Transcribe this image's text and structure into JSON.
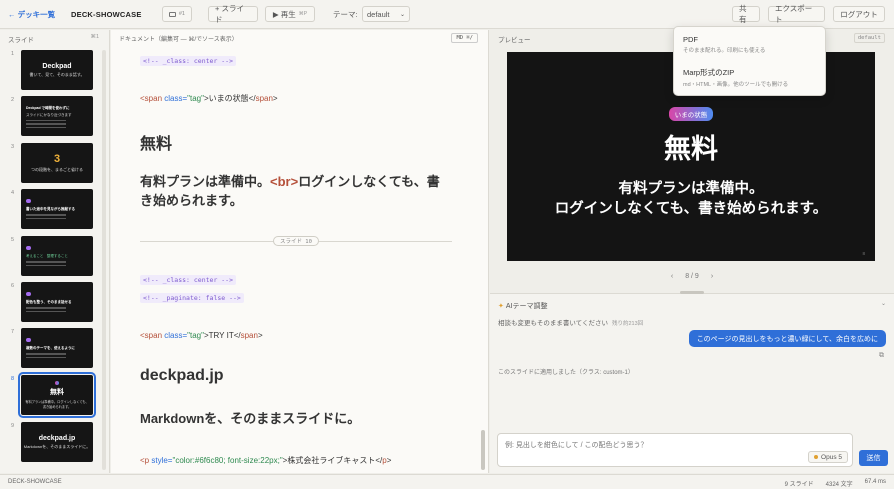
{
  "topbar": {
    "back": "← デッキ一覧",
    "title": "DECK-SHOWCASE",
    "slide_indicator": "#1",
    "add_slide": "+ スライド",
    "play": "▶ 再生",
    "play_shortcut": "⌘P",
    "theme_label": "テーマ:",
    "theme_value": "default",
    "share": "共有",
    "export": "エクスポート",
    "logout": "ログアウト"
  },
  "sidebar": {
    "header": "スライド",
    "header_right": "⌘1",
    "thumbs": [
      {
        "num": "1",
        "t1": "Deckpad",
        "t2": "書いて、見て、そのまま話す。"
      },
      {
        "num": "2",
        "t1": "Deckpad で時間を使わずに",
        "t2": "スライドにかなり近づきます"
      },
      {
        "num": "3",
        "big": "3",
        "t2": "つの段階を、まるごと省ける"
      },
      {
        "num": "4",
        "t1": "書いた途中を見ながら推敲する",
        "t2": ""
      },
      {
        "num": "5",
        "t1": "考えること　整理すること",
        "t2": ""
      },
      {
        "num": "6",
        "t1": "配色も整う、そのまま話せる",
        "t2": ""
      },
      {
        "num": "7",
        "t1": "複数のテーマを、使えるように",
        "t2": ""
      },
      {
        "num": "8",
        "t1": "無料",
        "t2": "有料プランは準備中。ログインしなくても、書き始められます。"
      },
      {
        "num": "9",
        "t1": "deckpad.jp",
        "t2": "Markdownを、そのままスライドに。"
      }
    ]
  },
  "doc": {
    "header": "ドキュメント（編集可 — ⌘/でソース表示）",
    "md_button": "MD ⌘/",
    "comment_center": "<!-- _class: center -->",
    "tag_open": "<span",
    "tag_attr": "class=",
    "tag_val": "\"tag\"",
    "tag_text1": ">いまの状態</",
    "tag_close": "span",
    "tag_end": ">",
    "h1_free": "無料",
    "para1_a": "有料プランは準備中。",
    "para1_br": "<br>",
    "para1_b": "ログインしなくても、書き始められます。",
    "separator": "スライド 10",
    "comment_center2": "<!-- _class: center -->",
    "comment_paginate": "<!-- _paginate: false -->",
    "tag_text2": ">TRY IT</",
    "h1_deckpad": "deckpad.jp",
    "para2": "Markdownを、そのままスライドに。",
    "p_open": "<p",
    "p_attr": "style=",
    "p_style": "\"color:#6f6c80; font-size:22px;\"",
    "p_text": ">株式会社ライブキャスト</",
    "p_close": "p"
  },
  "preview": {
    "header": "プレビュー",
    "theme_tag": "default",
    "badge": "いまの状態",
    "title": "無料",
    "body_line1": "有料プランは準備中。",
    "body_line2": "ログインしなくても、書き始められます。",
    "page_small": "8",
    "pager_prev": "‹",
    "pager_text": "8 / 9",
    "pager_next": "›"
  },
  "ai": {
    "header": "AIテーマ調整",
    "note": "相談も変更もそのまま書いてください",
    "note_remaining": "残り約213回",
    "user_message": "このページの見出しをもっと濃い緑にして、余白を広めに",
    "applied": "このスライドに適用しました（クラス: custom-1）",
    "placeholder": "例: 見出しを紺色にして / この配色どう思う？",
    "model": "Opus 5",
    "send": "送信"
  },
  "dropdown": {
    "items": [
      {
        "title": "PDF",
        "desc": "そのまま配れる。印刷にも使える"
      },
      {
        "title": "Marp形式のZIP",
        "desc": "md・HTML・画像。他のツールでも開ける"
      }
    ]
  },
  "status": {
    "left": "DECK-SHOWCASE",
    "slides": "9 スライド",
    "chars": "4324 文字",
    "ms": "67.4 ms"
  }
}
